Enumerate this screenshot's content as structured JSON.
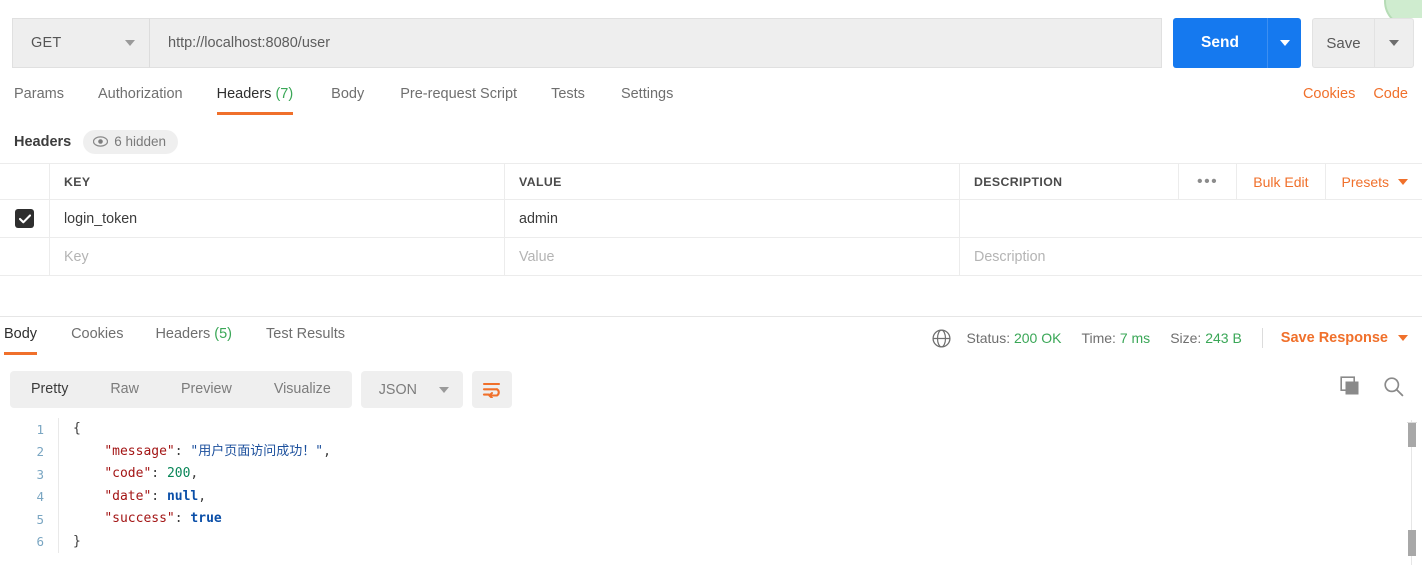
{
  "request": {
    "method": "GET",
    "url": "http://localhost:8080/user",
    "send_label": "Send",
    "save_label": "Save",
    "tabs": [
      {
        "label": "Params",
        "count": "",
        "active": false
      },
      {
        "label": "Authorization",
        "count": "",
        "active": false
      },
      {
        "label": "Headers",
        "count": "(7)",
        "active": true
      },
      {
        "label": "Body",
        "count": "",
        "active": false
      },
      {
        "label": "Pre-request Script",
        "count": "",
        "active": false
      },
      {
        "label": "Tests",
        "count": "",
        "active": false
      },
      {
        "label": "Settings",
        "count": "",
        "active": false
      }
    ],
    "links": [
      {
        "label": "Cookies"
      },
      {
        "label": "Code"
      }
    ]
  },
  "headers_panel": {
    "title": "Headers",
    "hidden_badge": "6 hidden",
    "columns": [
      "KEY",
      "VALUE",
      "DESCRIPTION"
    ],
    "actions": {
      "dots": "•••",
      "bulk_edit": "Bulk Edit",
      "presets": "Presets"
    },
    "rows": [
      {
        "checked": true,
        "key": "login_token",
        "value": "admin",
        "description": ""
      }
    ],
    "new_row": {
      "key_placeholder": "Key",
      "value_placeholder": "Value",
      "description_placeholder": "Description"
    }
  },
  "response": {
    "tabs": [
      {
        "label": "Body",
        "count": "",
        "active": true
      },
      {
        "label": "Cookies",
        "count": "",
        "active": false
      },
      {
        "label": "Headers",
        "count": "(5)",
        "active": false
      },
      {
        "label": "Test Results",
        "count": "",
        "active": false
      }
    ],
    "status": {
      "status_label": "Status:",
      "status_value": "200 OK",
      "time_label": "Time:",
      "time_value": "7 ms",
      "size_label": "Size:",
      "size_value": "243 B"
    },
    "save_response": "Save Response",
    "view_modes": [
      {
        "label": "Pretty",
        "active": true
      },
      {
        "label": "Raw",
        "active": false
      },
      {
        "label": "Preview",
        "active": false
      },
      {
        "label": "Visualize",
        "active": false
      }
    ],
    "format": "JSON",
    "body_lines": [
      {
        "n": "1",
        "tokens": [
          {
            "t": "{",
            "c": "p"
          }
        ]
      },
      {
        "n": "2",
        "tokens": [
          {
            "t": "    ",
            "c": "p"
          },
          {
            "t": "\"message\"",
            "c": "k"
          },
          {
            "t": ": ",
            "c": "p"
          },
          {
            "t": "\"用户页面访问成功！\"",
            "c": "s"
          },
          {
            "t": ",",
            "c": "p"
          }
        ]
      },
      {
        "n": "3",
        "tokens": [
          {
            "t": "    ",
            "c": "p"
          },
          {
            "t": "\"code\"",
            "c": "k"
          },
          {
            "t": ": ",
            "c": "p"
          },
          {
            "t": "200",
            "c": "n"
          },
          {
            "t": ",",
            "c": "p"
          }
        ]
      },
      {
        "n": "4",
        "tokens": [
          {
            "t": "    ",
            "c": "p"
          },
          {
            "t": "\"date\"",
            "c": "k"
          },
          {
            "t": ": ",
            "c": "p"
          },
          {
            "t": "null",
            "c": "b"
          },
          {
            "t": ",",
            "c": "p"
          }
        ]
      },
      {
        "n": "5",
        "tokens": [
          {
            "t": "    ",
            "c": "p"
          },
          {
            "t": "\"success\"",
            "c": "k"
          },
          {
            "t": ": ",
            "c": "p"
          },
          {
            "t": "true",
            "c": "b"
          }
        ]
      },
      {
        "n": "6",
        "tokens": [
          {
            "t": "}",
            "c": "p"
          }
        ]
      }
    ]
  },
  "colors": {
    "accent_orange": "#f0702b",
    "send_blue": "#1579ef",
    "success_green": "#3aa757"
  }
}
